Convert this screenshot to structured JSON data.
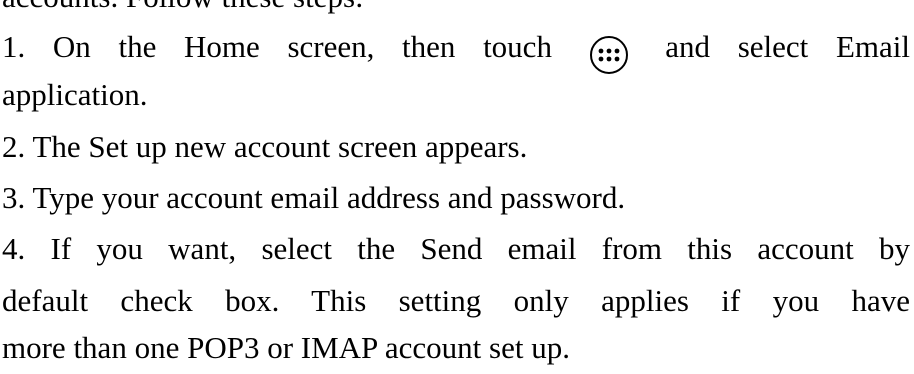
{
  "intro": "accounts. Follow these steps:",
  "step1": {
    "before_icon": "1. On the Home screen, then touch",
    "icon": "app-launcher-icon",
    "after_icon": "and select Email",
    "continuation": "application."
  },
  "step2": "2. The Set up new account screen appears.",
  "step3": "3. Type your account email address and password.",
  "step4": {
    "line1": "4. If you want, select the Send email from this account by",
    "line2": "default check box. This setting only applies if you have",
    "line3": "more than one POP3 or IMAP account set up."
  }
}
